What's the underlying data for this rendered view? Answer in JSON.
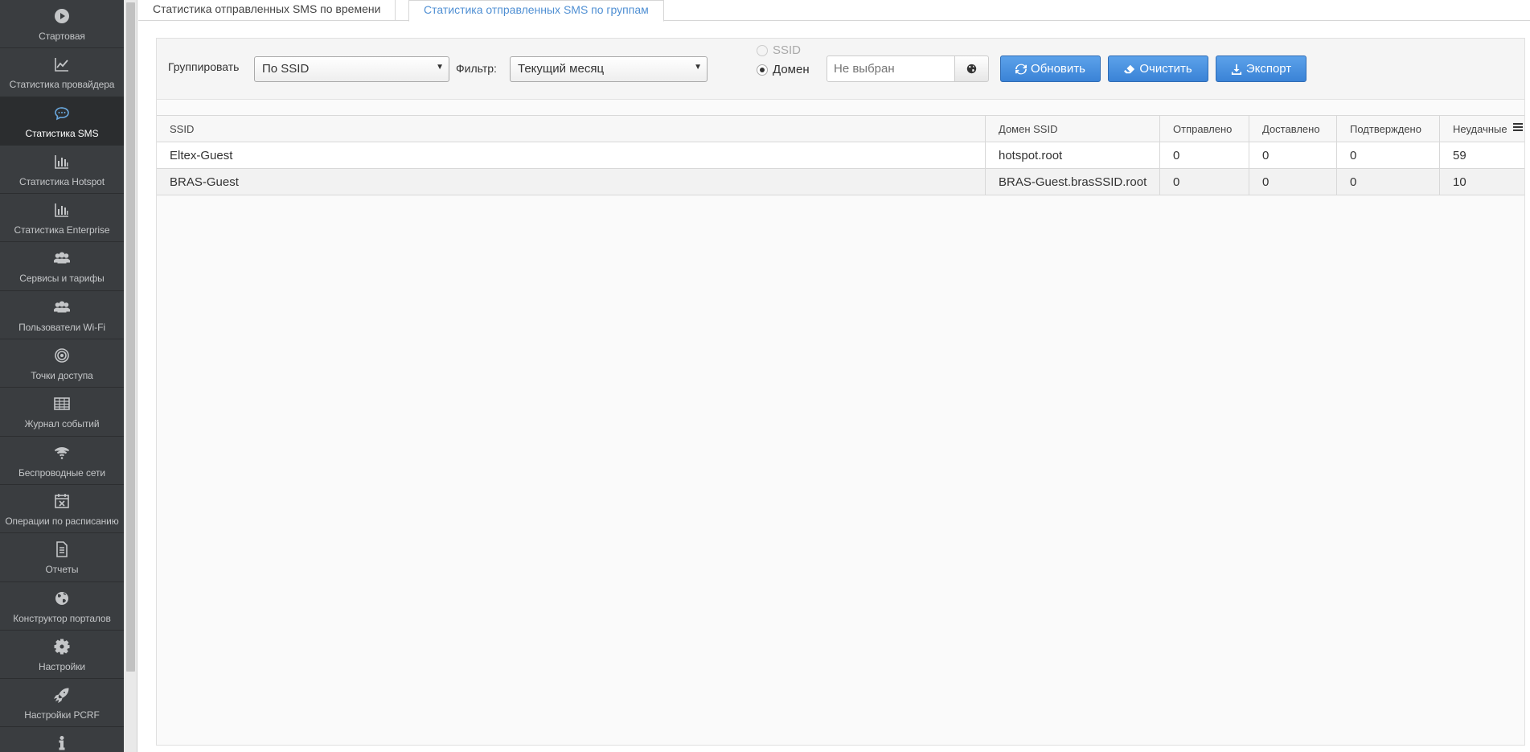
{
  "sidebar": {
    "items": [
      {
        "label": "Стартовая",
        "icon": "play-circle-icon",
        "active": false
      },
      {
        "label": "Статистика провайдера",
        "icon": "line-chart-icon",
        "active": false
      },
      {
        "label": "Статистика SMS",
        "icon": "chat-bubble-icon",
        "active": true
      },
      {
        "label": "Статистика Hotspot",
        "icon": "bar-chart-icon",
        "active": false
      },
      {
        "label": "Статистика Enterprise",
        "icon": "bar-chart-icon",
        "active": false
      },
      {
        "label": "Сервисы и тарифы",
        "icon": "users-icon",
        "active": false
      },
      {
        "label": "Пользователи Wi-Fi",
        "icon": "users-icon",
        "active": false
      },
      {
        "label": "Точки доступа",
        "icon": "target-icon",
        "active": false
      },
      {
        "label": "Журнал событий",
        "icon": "table-icon",
        "active": false
      },
      {
        "label": "Беспроводные сети",
        "icon": "wifi-icon",
        "active": false
      },
      {
        "label": "Операции по расписанию",
        "icon": "calendar-icon",
        "active": false
      },
      {
        "label": "Отчеты",
        "icon": "document-icon",
        "active": false
      },
      {
        "label": "Конструктор порталов",
        "icon": "globe-icon",
        "active": false
      },
      {
        "label": "Настройки",
        "icon": "gear-icon",
        "active": false
      },
      {
        "label": "Настройки PCRF",
        "icon": "rocket-icon",
        "active": false
      },
      {
        "label": "",
        "icon": "info-icon",
        "active": false
      }
    ]
  },
  "tabs": {
    "time": "Статистика отправленных SMS по времени",
    "groups": "Статистика отправленных SMS по группам"
  },
  "toolbar": {
    "group_label": "Группировать",
    "group_value": "По SSID",
    "filter_label": "Фильтр:",
    "filter_value": "Текущий месяц",
    "radio_ssid": "SSID",
    "radio_domain": "Домен",
    "domain_placeholder": "Не выбран",
    "refresh_label": "Обновить",
    "clear_label": "Очистить",
    "export_label": "Экспорт"
  },
  "table": {
    "columns": [
      "SSID",
      "Домен SSID",
      "Отправлено",
      "Доставлено",
      "Подтверждено",
      "Неудачные"
    ],
    "rows": [
      [
        "Eltex-Guest",
        "hotspot.root",
        "0",
        "0",
        "0",
        "59"
      ],
      [
        "BRAS-Guest",
        "BRAS-Guest.brasSSID.root",
        "0",
        "0",
        "0",
        "10"
      ]
    ]
  },
  "colors": {
    "sidebar_bg": "#3a3d40",
    "accent": "#4f8fd3",
    "button": "#3a83d6"
  }
}
